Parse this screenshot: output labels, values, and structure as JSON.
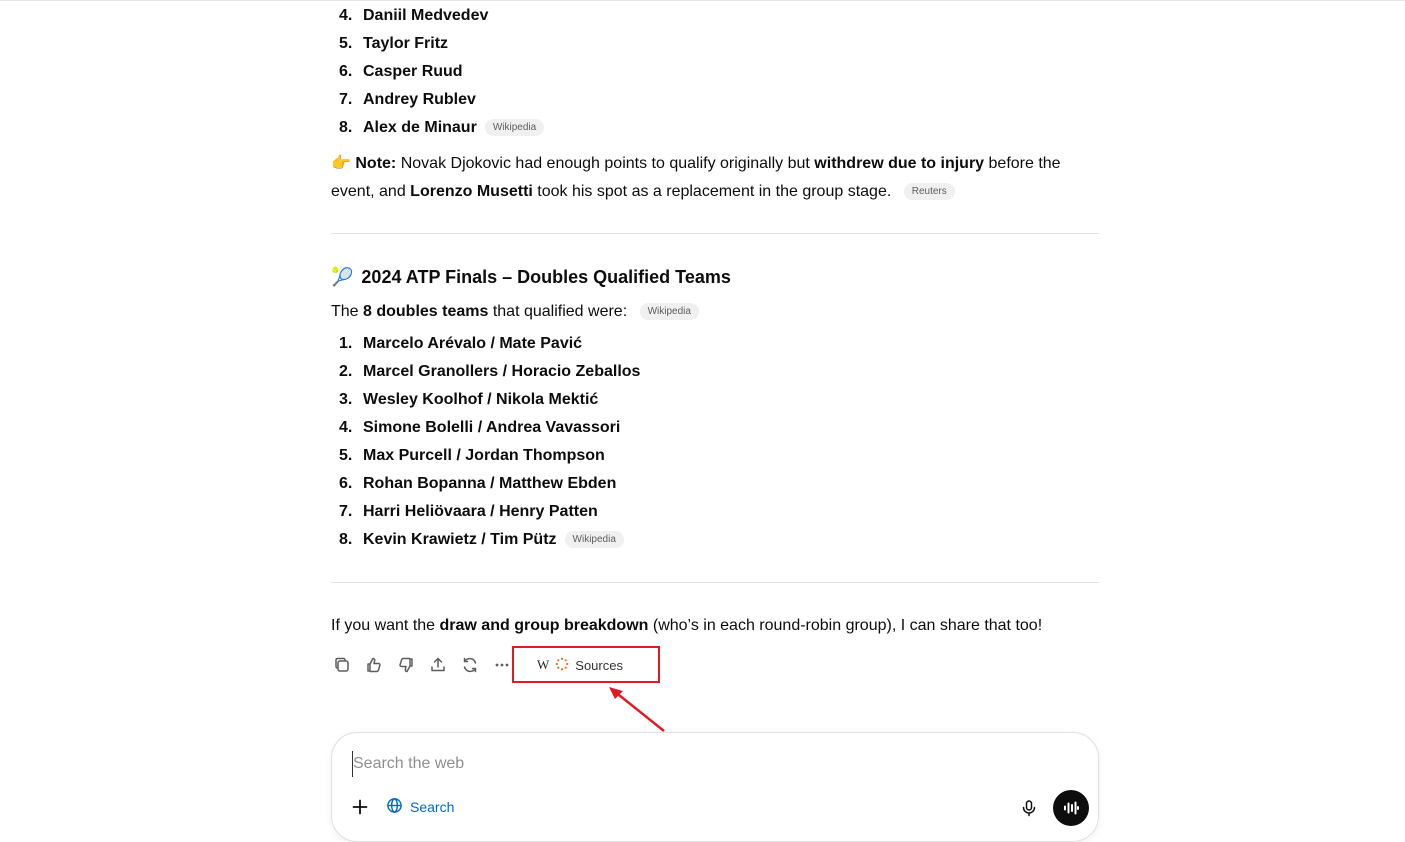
{
  "singles_list": [
    {
      "num": "4.",
      "name": "Daniil Medvedev"
    },
    {
      "num": "5.",
      "name": "Taylor Fritz"
    },
    {
      "num": "6.",
      "name": "Casper Ruud"
    },
    {
      "num": "7.",
      "name": "Andrey Rublev"
    },
    {
      "num": "8.",
      "name": "Alex de Minaur",
      "source": "Wikipedia"
    }
  ],
  "note": {
    "emoji": "👉",
    "label": "Note:",
    "text1": " Novak Djokovic had enough points to qualify originally but ",
    "bold1": "withdrew due to injury",
    "text2": " before the event, and ",
    "bold2": "Lorenzo Musetti",
    "text3": " took his spot as a replacement in the group stage.",
    "source": "Reuters"
  },
  "doubles": {
    "emoji": "🎾",
    "heading": "2024 ATP Finals – Doubles Qualified Teams",
    "intro_pre": "The ",
    "intro_bold": "8 doubles teams",
    "intro_post": " that qualified were:",
    "intro_source": "Wikipedia",
    "teams": [
      {
        "num": "1.",
        "name": "Marcelo Arévalo / Mate Pavić"
      },
      {
        "num": "2.",
        "name": "Marcel Granollers / Horacio Zeballos"
      },
      {
        "num": "3.",
        "name": "Wesley Koolhof / Nikola Mektić"
      },
      {
        "num": "4.",
        "name": "Simone Bolelli / Andrea Vavassori"
      },
      {
        "num": "5.",
        "name": "Max Purcell / Jordan Thompson"
      },
      {
        "num": "6.",
        "name": "Rohan Bopanna / Matthew Ebden"
      },
      {
        "num": "7.",
        "name": "Harri Heliövaara / Henry Patten"
      },
      {
        "num": "8.",
        "name": "Kevin Krawietz / Tim Pütz",
        "source": "Wikipedia"
      }
    ]
  },
  "closing": {
    "pre": "If you want the ",
    "bold": "draw and group breakdown",
    "post": " (who’s in each round-robin group), I can share that too!"
  },
  "actions": {
    "icons": [
      "copy-icon",
      "thumbs-up-icon",
      "thumbs-down-icon",
      "share-icon",
      "regenerate-icon",
      "more-icon"
    ],
    "sources_label": "Sources",
    "sources_favicon_letter": "W"
  },
  "composer": {
    "placeholder": "Search the web",
    "search_label": "Search"
  },
  "colors": {
    "accent_blue": "#0169cc",
    "highlight_red": "#e01b24"
  }
}
